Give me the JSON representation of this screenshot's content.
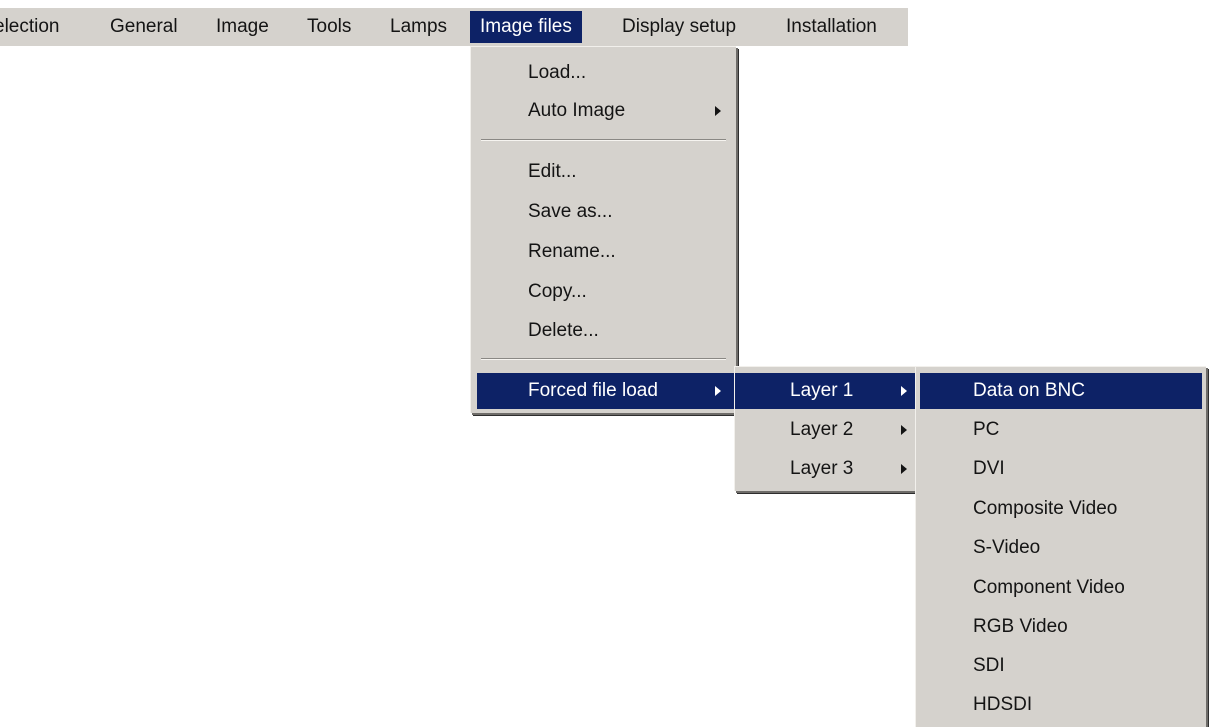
{
  "menubar": {
    "items": [
      {
        "label": "election"
      },
      {
        "label": "General"
      },
      {
        "label": "Image"
      },
      {
        "label": "Tools"
      },
      {
        "label": "Lamps"
      },
      {
        "label": "Image files"
      },
      {
        "label": "Display setup"
      },
      {
        "label": "Installation"
      }
    ],
    "active_index": 5
  },
  "image_files_menu": {
    "items": [
      {
        "label": "Load..."
      },
      {
        "label": "Auto Image"
      },
      {
        "label": "Edit..."
      },
      {
        "label": "Save as..."
      },
      {
        "label": "Rename..."
      },
      {
        "label": "Copy..."
      },
      {
        "label": "Delete..."
      },
      {
        "label": "Forced file load"
      }
    ]
  },
  "forced_file_load_menu": {
    "items": [
      {
        "label": "Layer 1"
      },
      {
        "label": "Layer 2"
      },
      {
        "label": "Layer 3"
      }
    ]
  },
  "layer1_menu": {
    "items": [
      {
        "label": "Data on BNC"
      },
      {
        "label": "PC"
      },
      {
        "label": "DVI"
      },
      {
        "label": "Composite Video"
      },
      {
        "label": "S-Video"
      },
      {
        "label": "Component Video"
      },
      {
        "label": "RGB Video"
      },
      {
        "label": "SDI"
      },
      {
        "label": "HDSDI"
      }
    ]
  },
  "colors": {
    "menu_background": "#d5d2cd",
    "highlight": "#0d2266",
    "highlight_text": "#ffffff",
    "text": "#141414"
  }
}
